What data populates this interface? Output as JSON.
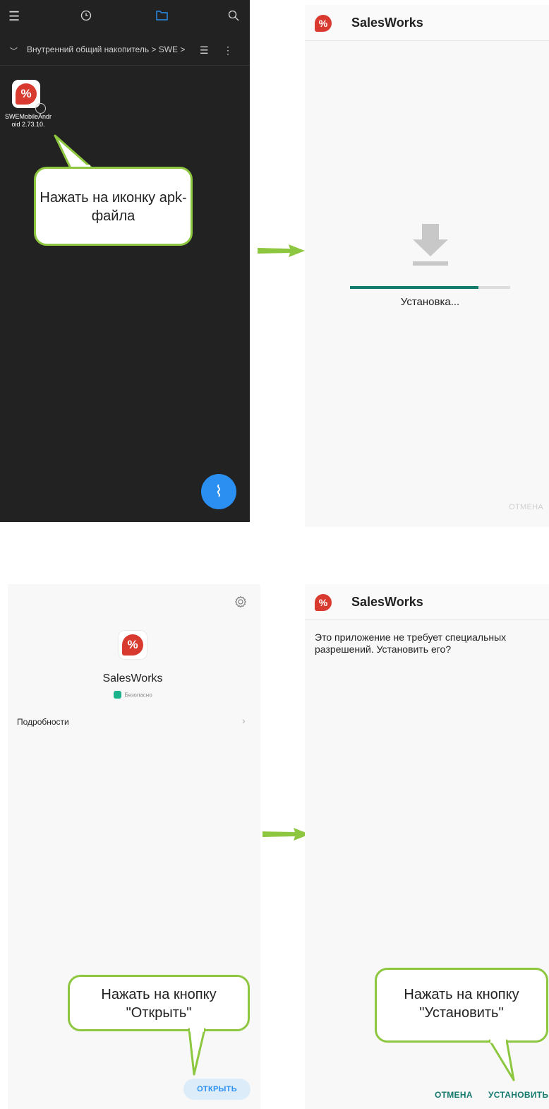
{
  "panel1": {
    "icons": [
      "menu-icon",
      "clock-icon",
      "folder-icon",
      "search-icon",
      "chevron-down-icon",
      "list-view-icon",
      "more-vert-icon",
      "broom-icon"
    ],
    "breadcrumb": "Внутренний общий накопитель > SWE >",
    "file_name": "SWEMobileAndroid 2.73.10.",
    "callout": "Нажать на иконку apk-файла"
  },
  "panel2": {
    "title": "SalesWorks",
    "status": "Установка...",
    "progress": 0.8,
    "cancel": "ОТМЕНА"
  },
  "panel3": {
    "app_name": "SalesWorks",
    "safe_badge": "Безопасно",
    "details": "Подробности",
    "open_button": "ОТКРЫТЬ",
    "callout_line1": "Нажать на кнопку",
    "callout_line2": "\"Открыть\""
  },
  "panel4": {
    "title": "SalesWorks",
    "message": "Это приложение не требует специальных разрешений. Установить его?",
    "cancel": "ОТМЕНА",
    "install": "УСТАНОВИТЬ",
    "callout_line1": "Нажать на кнопку",
    "callout_line2": "\"Установить\""
  },
  "colors": {
    "accent_teal": "#137a6d",
    "callout_border": "#8dc63f",
    "arrow": "#8dc63f",
    "fab_blue": "#2a8ff0",
    "logo_red": "#d83a30"
  }
}
